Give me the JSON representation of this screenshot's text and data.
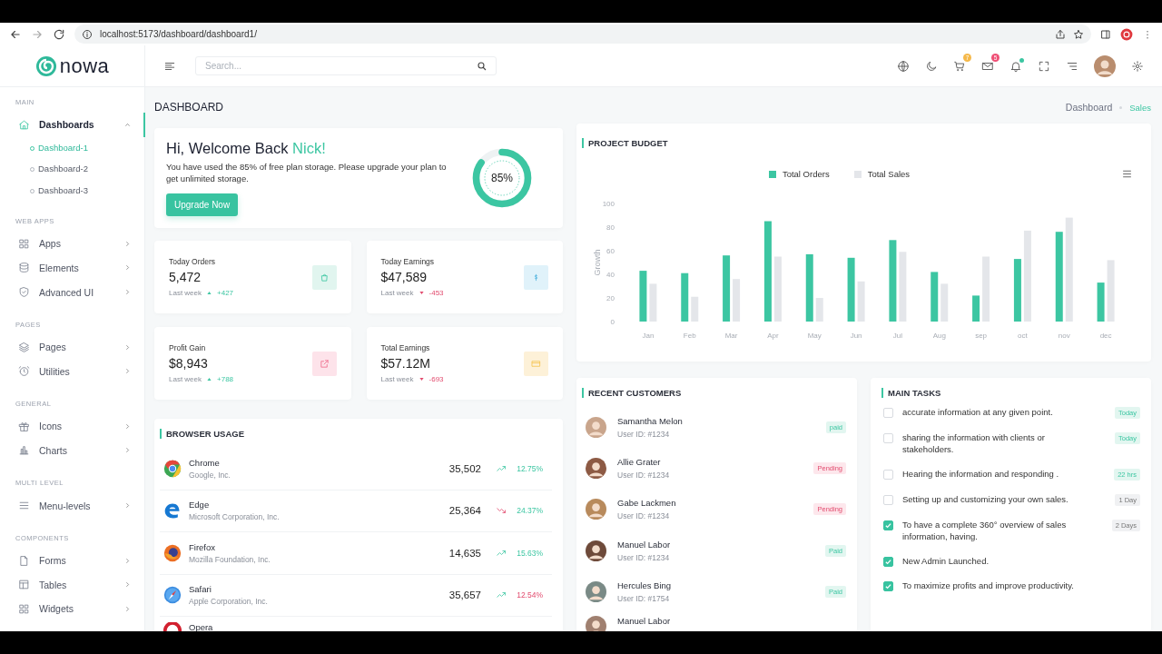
{
  "browser": {
    "url": "localhost:5173/dashboard/dashboard1/"
  },
  "logo": {
    "text": "nowa"
  },
  "sidebar": {
    "sections": [
      {
        "label": "MAIN",
        "items": [
          {
            "label": "Dashboards",
            "expanded": true,
            "selected": true,
            "children": [
              {
                "label": "Dashboard-1",
                "selected": true
              },
              {
                "label": "Dashboard-2",
                "selected": false
              },
              {
                "label": "Dashboard-3",
                "selected": false
              }
            ]
          }
        ]
      },
      {
        "label": "WEB APPS",
        "items": [
          {
            "label": "Apps",
            "expanded": false,
            "selected": false
          },
          {
            "label": "Elements",
            "expanded": false,
            "selected": false
          },
          {
            "label": "Advanced UI",
            "expanded": false,
            "selected": false
          }
        ]
      },
      {
        "label": "PAGES",
        "items": [
          {
            "label": "Pages",
            "expanded": false,
            "selected": false
          },
          {
            "label": "Utilities",
            "expanded": false,
            "selected": false
          }
        ]
      },
      {
        "label": "GENERAL",
        "items": [
          {
            "label": "Icons",
            "expanded": false,
            "selected": false
          },
          {
            "label": "Charts",
            "expanded": false,
            "selected": false
          }
        ]
      },
      {
        "label": "MULTI LEVEL",
        "items": [
          {
            "label": "Menu-levels",
            "expanded": false,
            "selected": false
          }
        ]
      },
      {
        "label": "COMPONENTS",
        "items": [
          {
            "label": "Forms",
            "expanded": false,
            "selected": false
          },
          {
            "label": "Tables",
            "expanded": false,
            "selected": false
          },
          {
            "label": "Widgets",
            "expanded": false,
            "selected": false
          }
        ]
      }
    ]
  },
  "header": {
    "search": {
      "placeholder": "Search..."
    },
    "cart_badge": "7",
    "mail_badge": "5"
  },
  "page": {
    "title": "DASHBOARD",
    "breadcrumb": [
      {
        "label": "Dashboard",
        "selected": false
      },
      {
        "label": "Sales",
        "selected": true
      }
    ]
  },
  "welcome": {
    "greeting": "Hi, Welcome Back",
    "name": "Nick!",
    "message": "You have used the 85% of free plan storage. Please upgrade your plan to get unlimited storage.",
    "button": "Upgrade Now",
    "storage": {
      "level": 0.85,
      "label": "85%"
    }
  },
  "stats": [
    {
      "title": "Today Orders",
      "value": "5,472",
      "period": "Last week",
      "rising": true,
      "change": "+427"
    },
    {
      "title": "Today Earnings",
      "value": "$47,589",
      "period": "Last week",
      "rising": false,
      "change": "-453"
    },
    {
      "title": "Profit Gain",
      "value": "$8,943",
      "period": "Last week",
      "rising": true,
      "change": "+788"
    },
    {
      "title": "Total Earnings",
      "value": "$57.12M",
      "period": "Last week",
      "rising": false,
      "change": "-693"
    }
  ],
  "browser_usage": {
    "title": "BROWSER USAGE",
    "rows": [
      {
        "name": "Chrome",
        "company": "Google, Inc.",
        "count": "35,502",
        "rising": true,
        "change": "12.75%",
        "positive": true
      },
      {
        "name": "Edge",
        "company": "Microsoft Corporation, Inc.",
        "count": "25,364",
        "rising": false,
        "change": "24.37%",
        "positive": true
      },
      {
        "name": "Firefox",
        "company": "Mozilla Foundation, Inc.",
        "count": "14,635",
        "rising": true,
        "change": "15.63%",
        "positive": true
      },
      {
        "name": "Safari",
        "company": "Apple Corporation, Inc.",
        "count": "35,657",
        "rising": true,
        "change": "12.54%",
        "positive": false
      },
      {
        "name": "Opera"
      }
    ]
  },
  "project_budget": {
    "title": "PROJECT BUDGET",
    "chart_data": {
      "type": "bar",
      "ylabel": "Growth",
      "categories": [
        "Jan",
        "Feb",
        "Mar",
        "Apr",
        "May",
        "Jun",
        "Jul",
        "Aug",
        "sep",
        "oct",
        "nov",
        "dec"
      ],
      "series": [
        {
          "name": "Total Orders",
          "color": "#3cc6a2",
          "values": [
            43,
            41,
            56,
            85,
            57,
            54,
            69,
            42,
            22,
            53,
            76,
            33
          ]
        },
        {
          "name": "Total Sales",
          "color": "#e4e6ea",
          "values": [
            32,
            21,
            36,
            55,
            20,
            34,
            59,
            32,
            55,
            77,
            88,
            52
          ]
        }
      ],
      "ylim": [
        0,
        100
      ],
      "yticks": [
        0,
        20,
        40,
        60,
        80,
        100
      ]
    }
  },
  "recent_customers": {
    "title": "RECENT CUSTOMERS",
    "rows": [
      {
        "name": "Samantha Melon",
        "user_id": "User ID: #1234",
        "status": "paid",
        "kind": "paid"
      },
      {
        "name": "Allie Grater",
        "user_id": "User ID: #1234",
        "status": "Pending",
        "kind": "pending"
      },
      {
        "name": "Gabe Lackmen",
        "user_id": "User ID: #1234",
        "status": "Pending",
        "kind": "pending"
      },
      {
        "name": "Manuel Labor",
        "user_id": "User ID: #1234",
        "status": "Paid",
        "kind": "paid"
      },
      {
        "name": "Hercules Bing",
        "user_id": "User ID: #1754",
        "status": "Paid",
        "kind": "paid"
      },
      {
        "name": "Manuel Labor"
      }
    ]
  },
  "main_tasks": {
    "title": "MAIN TASKS",
    "rows": [
      {
        "text": "accurate information at any given point.",
        "checked": false,
        "badge": "Today",
        "badge_highlighted": true
      },
      {
        "text": "sharing the information with clients or stakeholders.",
        "checked": false,
        "badge": "Today",
        "badge_highlighted": true
      },
      {
        "text": "Hearing the information and responding .",
        "checked": false,
        "badge": "22 hrs",
        "badge_highlighted": true
      },
      {
        "text": "Setting up and customizing your own sales.",
        "checked": false,
        "badge": "1 Day",
        "badge_highlighted": false
      },
      {
        "text": "To have a complete 360° overview of sales information, having.",
        "checked": true,
        "badge": "2 Days",
        "badge_highlighted": false
      },
      {
        "text": "New Admin Launched.",
        "checked": true
      },
      {
        "text": "To maximize profits and improve productivity.",
        "checked": true
      }
    ]
  }
}
